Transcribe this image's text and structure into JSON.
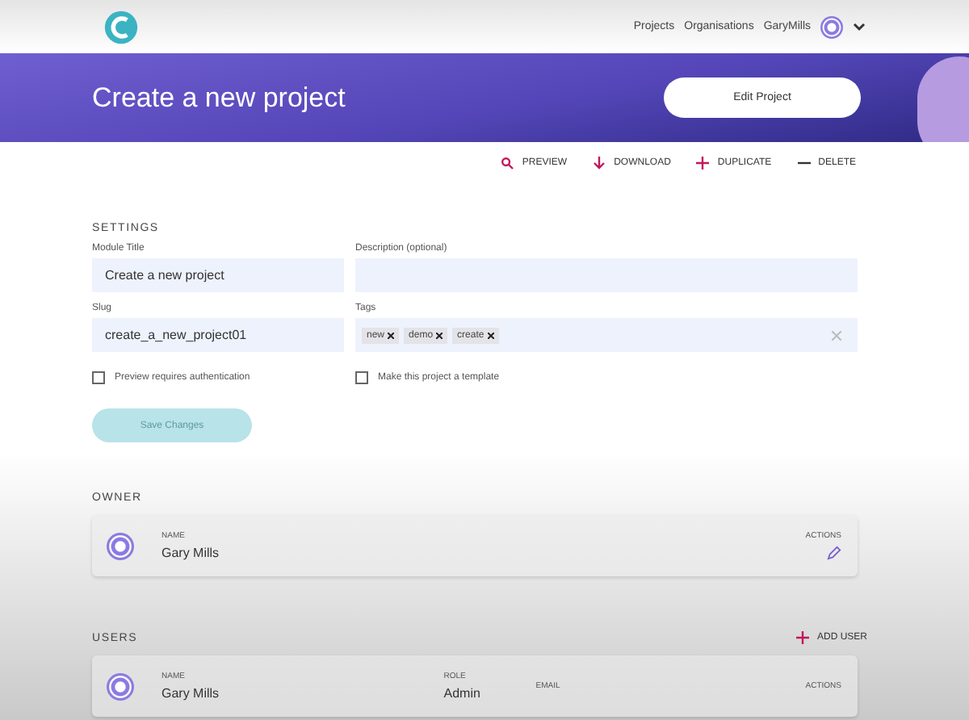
{
  "nav": {
    "links": [
      "Projects",
      "Organisations"
    ],
    "user_name": "GaryMills"
  },
  "banner": {
    "title": "Create a new project",
    "edit_button": "Edit Project"
  },
  "actions": [
    {
      "kind": "preview",
      "label": "PREVIEW"
    },
    {
      "kind": "download",
      "label": "DOWNLOAD"
    },
    {
      "kind": "duplicate",
      "label": "DUPLICATE"
    },
    {
      "kind": "delete",
      "label": "DELETE"
    }
  ],
  "settings": {
    "heading": "SETTINGS",
    "module_title": {
      "label": "Module Title",
      "value": "Create a new project"
    },
    "description": {
      "label": "Description (optional)"
    },
    "slug": {
      "label": "Slug",
      "value": "create_a_new_project01"
    },
    "tags": {
      "label": "Tags",
      "items": [
        "new",
        "demo",
        "create"
      ]
    },
    "checkboxes": [
      {
        "label": "Preview requires authentication",
        "checked": false
      },
      {
        "label": "Make this project a template",
        "checked": false
      }
    ],
    "save_button": {
      "label": "Save Changes",
      "disabled": true
    }
  },
  "owner": {
    "heading": "OWNER",
    "name_label": "NAME",
    "name": "Gary Mills",
    "actions_label": "ACTIONS"
  },
  "users": {
    "heading": "USERS",
    "add_button": "ADD USER",
    "name_label": "NAME",
    "role_label": "ROLE",
    "email_label": "EMAIL",
    "actions_label": "ACTIONS",
    "rows": [
      {
        "name": "Gary Mills",
        "role": "Admin"
      }
    ]
  }
}
